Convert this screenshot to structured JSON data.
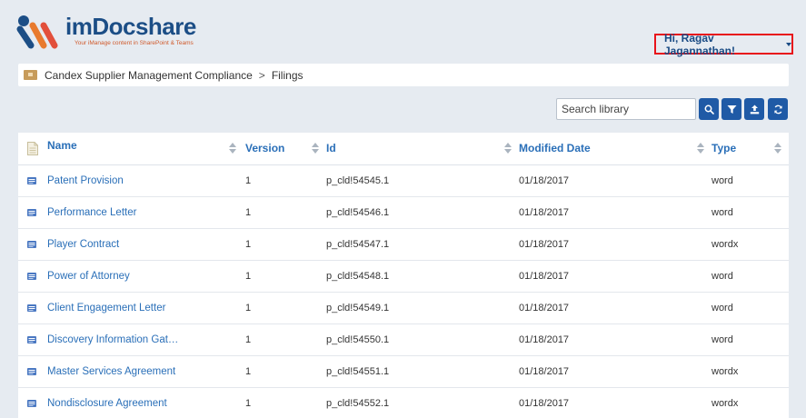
{
  "brand": {
    "name": "imDocshare",
    "tagline": "Your iManage content in SharePoint & Teams"
  },
  "user_menu": {
    "label": "Hi, Ragav Jagannathan!"
  },
  "breadcrumb": {
    "items": [
      "Candex Supplier Management Compliance",
      "Filings"
    ],
    "separator": ">"
  },
  "toolbar": {
    "search_placeholder": "Search library",
    "buttons": [
      "search-icon",
      "filter-icon",
      "upload-icon",
      "refresh-icon"
    ]
  },
  "table": {
    "headers": [
      "Name",
      "Version",
      "Id",
      "Modified Date",
      "Type"
    ],
    "rows": [
      {
        "name": "Patent Provision",
        "version": "1",
        "id": "p_cld!54545.1",
        "modified": "01/18/2017",
        "type": "word"
      },
      {
        "name": "Performance Letter",
        "version": "1",
        "id": "p_cld!54546.1",
        "modified": "01/18/2017",
        "type": "word"
      },
      {
        "name": "Player Contract",
        "version": "1",
        "id": "p_cld!54547.1",
        "modified": "01/18/2017",
        "type": "wordx"
      },
      {
        "name": "Power of Attorney",
        "version": "1",
        "id": "p_cld!54548.1",
        "modified": "01/18/2017",
        "type": "word"
      },
      {
        "name": "Client Engagement Letter",
        "version": "1",
        "id": "p_cld!54549.1",
        "modified": "01/18/2017",
        "type": "word"
      },
      {
        "name": "Discovery Information Gat…",
        "version": "1",
        "id": "p_cld!54550.1",
        "modified": "01/18/2017",
        "type": "word"
      },
      {
        "name": "Master Services Agreement",
        "version": "1",
        "id": "p_cld!54551.1",
        "modified": "01/18/2017",
        "type": "wordx"
      },
      {
        "name": "Nondisclosure Agreement",
        "version": "1",
        "id": "p_cld!54552.1",
        "modified": "01/18/2017",
        "type": "wordx"
      }
    ]
  },
  "colors": {
    "accent": "#1f5aa6",
    "link": "#2a6fb8",
    "highlight_border": "#e8141b",
    "background": "#e6ebf1"
  }
}
